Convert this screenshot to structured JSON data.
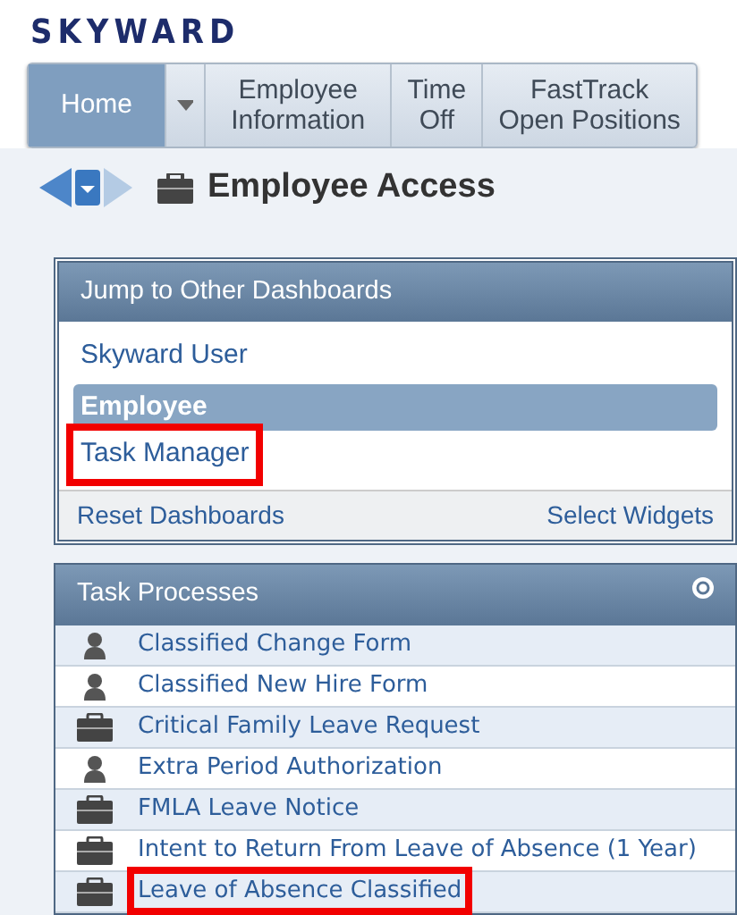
{
  "logo": {
    "text": "SKYWARD"
  },
  "nav": [
    {
      "label": "Home",
      "selected": true,
      "dropdown": true
    },
    {
      "label": "Employee Information",
      "selected": false,
      "dropdown": false
    },
    {
      "label": "Time Off",
      "selected": false,
      "dropdown": false
    },
    {
      "label": "FastTrack Open Positions",
      "selected": false,
      "dropdown": false
    }
  ],
  "page": {
    "title": "Employee Access"
  },
  "dashboards": {
    "title": "Jump to Other Dashboards",
    "items": [
      {
        "label": "Skyward User",
        "selected": false,
        "highlighted": false
      },
      {
        "label": "Employee",
        "selected": true,
        "highlighted": false
      },
      {
        "label": "Task Manager",
        "selected": false,
        "highlighted": true
      }
    ],
    "footer_left": "Reset Dashboards",
    "footer_right": "Select Widgets"
  },
  "tasks": {
    "title": "Task Processes",
    "items": [
      {
        "kind": "person",
        "label": "Classified Change Form",
        "highlighted": false
      },
      {
        "kind": "person",
        "label": "Classified New Hire Form",
        "highlighted": false
      },
      {
        "kind": "briefcase",
        "label": "Critical Family Leave Request",
        "highlighted": false
      },
      {
        "kind": "person",
        "label": "Extra Period Authorization",
        "highlighted": false
      },
      {
        "kind": "briefcase",
        "label": "FMLA Leave Notice",
        "highlighted": false
      },
      {
        "kind": "briefcase",
        "label": "Intent to Return From Leave of Absence (1 Year)",
        "highlighted": false
      },
      {
        "kind": "briefcase",
        "label": "Leave of Absence Classified",
        "highlighted": true
      }
    ]
  }
}
